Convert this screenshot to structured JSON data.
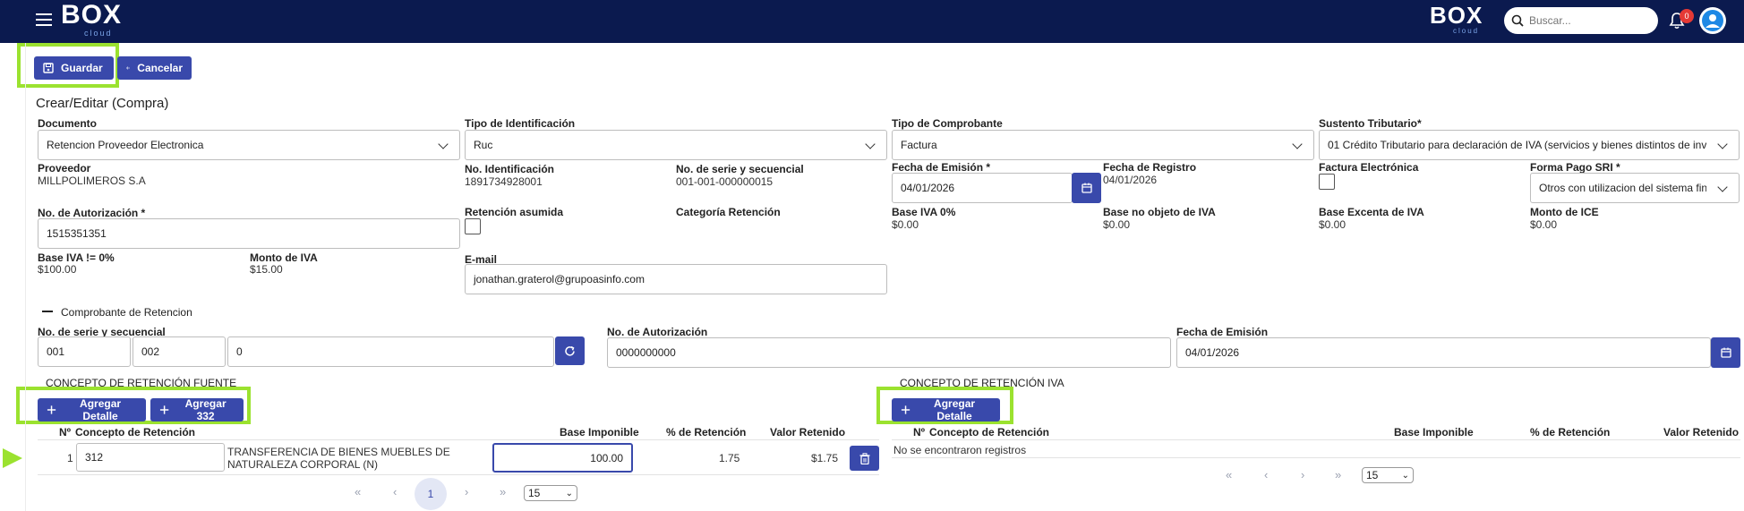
{
  "topbar": {
    "logo_text": "BOX",
    "logo_sub": "cloud",
    "right_logo_text": "BOX",
    "right_logo_sub": "cloud",
    "search_placeholder": "Buscar...",
    "notification_count": "0"
  },
  "toolbar": {
    "save_label": "Guardar",
    "cancel_label": "Cancelar"
  },
  "page_title": "Crear/Editar (Compra)",
  "form": {
    "documento": {
      "label": "Documento",
      "value": "Retencion Proveedor Electronica"
    },
    "tipo_identificacion": {
      "label": "Tipo de Identificación",
      "value": "Ruc"
    },
    "tipo_comprobante": {
      "label": "Tipo de Comprobante",
      "value": "Factura"
    },
    "sustento": {
      "label": "Sustento Tributario*",
      "value": "01 Crédito Tributario para declaración de IVA (servicios y bienes distintos de inve"
    },
    "proveedor": {
      "label": "Proveedor",
      "value": "MILLPOLIMEROS S.A"
    },
    "no_identificacion": {
      "label": "No. Identificación",
      "value": "1891734928001"
    },
    "serie_secuencial": {
      "label": "No. de serie y secuencial",
      "value": "001-001-000000015"
    },
    "fecha_emision": {
      "label": "Fecha de Emisión *",
      "value": "04/01/2026"
    },
    "fecha_registro": {
      "label": "Fecha de Registro",
      "value": "04/01/2026"
    },
    "factura_electronica": {
      "label": "Factura Electrónica"
    },
    "forma_pago": {
      "label": "Forma Pago SRI  *",
      "value": "Otros con utilizacion del sistema fin"
    },
    "autorizacion": {
      "label": "No. de Autorización *",
      "value": "1515351351"
    },
    "retencion_asumida": {
      "label": "Retención asumida"
    },
    "categoria_retencion": {
      "label": "Categoría Retención"
    },
    "base_iva_0": {
      "label": "Base IVA 0%",
      "value": "$0.00"
    },
    "base_no_objeto": {
      "label": "Base no objeto de IVA",
      "value": "$0.00"
    },
    "base_excenta": {
      "label": "Base Excenta de IVA",
      "value": "$0.00"
    },
    "monto_ice": {
      "label": "Monto de ICE",
      "value": "$0.00"
    },
    "base_iva_no0": {
      "label": "Base IVA != 0%",
      "value": "$100.00"
    },
    "monto_iva": {
      "label": "Monto de IVA",
      "value": "$15.00"
    },
    "email": {
      "label": "E-mail",
      "value": "jonathan.graterol@grupoasinfo.com"
    }
  },
  "comprobante": {
    "toggle_label": "Comprobante de Retencion",
    "serie_label": "No. de serie y secuencial",
    "serie_1": "001",
    "serie_2": "002",
    "serie_3": "0",
    "autorizacion_label": "No. de Autorización",
    "autorizacion_value": "0000000000",
    "fecha_label": "Fecha de Emisión",
    "fecha_value": "04/01/2026"
  },
  "fuente": {
    "title": "CONCEPTO DE RETENCIÓN FUENTE",
    "add_detail_label": "Agregar Detalle",
    "add_332_label": "Agregar 332",
    "headers": [
      "Nº",
      "Concepto de Retención",
      "Base Imponible",
      "% de Retención",
      "Valor Retenido"
    ],
    "rows": [
      {
        "n": "1",
        "codigo": "312",
        "descripcion_1": "TRANSFERENCIA DE BIENES MUEBLES DE",
        "descripcion_2": "NATURALEZA CORPORAL (N)",
        "base": "100.00",
        "porcentaje": "1.75",
        "valor": "$1.75"
      }
    ],
    "pager": {
      "page": "1",
      "page_size": "15"
    }
  },
  "iva": {
    "title": "CONCEPTO DE RETENCIÓN IVA",
    "add_detail_label": "Agregar Detalle",
    "headers": [
      "Nº",
      "Concepto de Retención",
      "Base Imponible",
      "% de Retención",
      "Valor Retenido"
    ],
    "empty_text": "No se encontraron registros",
    "pager": {
      "page_size": "15"
    }
  }
}
